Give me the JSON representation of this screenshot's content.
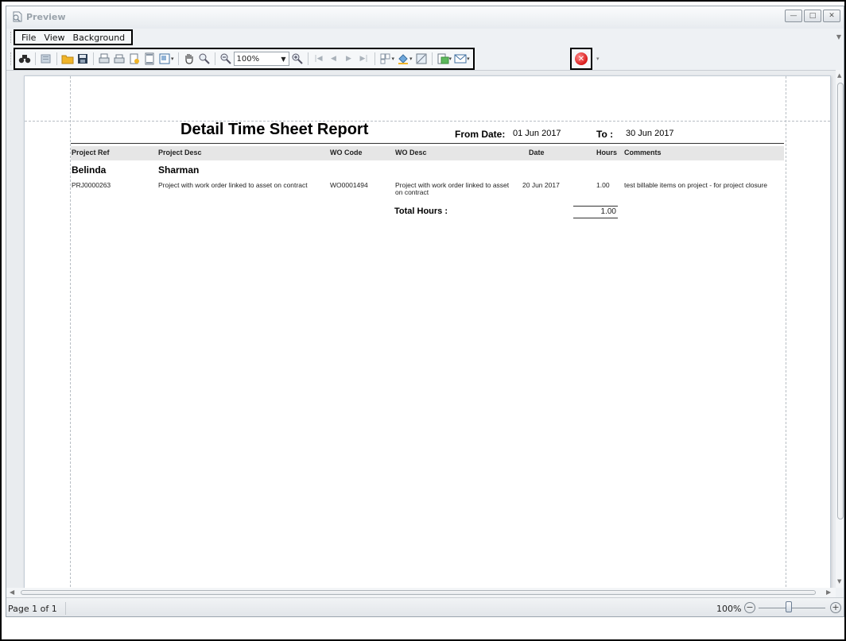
{
  "window": {
    "title": "Preview",
    "buttons": {
      "minimize": "—",
      "maximize": "□",
      "close": "✕"
    }
  },
  "menu": {
    "items": [
      {
        "label": "File"
      },
      {
        "label": "View"
      },
      {
        "label": "Background"
      }
    ]
  },
  "toolbar": {
    "zoom_value": "100%"
  },
  "report": {
    "title": "Detail Time Sheet Report",
    "from_label": "From Date:",
    "from_value": "01 Jun 2017",
    "to_label": "To :",
    "to_value": "30 Jun 2017",
    "columns": {
      "project_ref": "Project Ref",
      "project_desc": "Project Desc",
      "wo_code": "WO Code",
      "wo_desc": "WO Desc",
      "date": "Date",
      "hours": "Hours",
      "comments": "Comments"
    },
    "employee": {
      "first_name": "Belinda",
      "last_name": "Sharman"
    },
    "row": {
      "project_ref": "PRJ0000263",
      "project_desc": "Project with work order linked to asset on contract",
      "wo_code": "WO0001494",
      "wo_desc": "Project with work order linked to asset on contract",
      "date": "20 Jun 2017",
      "hours": "1.00",
      "comments": "test billable items on project - for project closure"
    },
    "total_label": "Total Hours :",
    "total_value": "1.00"
  },
  "status": {
    "page": "Page 1 of 1",
    "zoom": "100%",
    "zoom_level_percent": 100
  }
}
